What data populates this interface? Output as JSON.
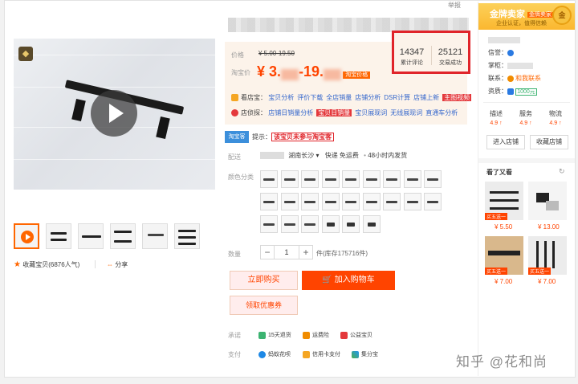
{
  "header": {
    "report_label": "举报"
  },
  "gallery": {
    "collect_label": "收藏宝贝",
    "collect_count": "(6876人气)",
    "share_label": "分享"
  },
  "price": {
    "price_label": "价格",
    "original_price": "¥ 5.00-19.50",
    "tb_price_label": "淘宝价",
    "tb_price_a": "¥ 3.",
    "tb_price_b": "-19.",
    "promo_tag": "淘宝价格"
  },
  "stats": [
    {
      "num": "14347",
      "cap": "累计评论"
    },
    {
      "num": "25121",
      "cap": "交易成功"
    }
  ],
  "tools": {
    "row1_label": "看店宝：",
    "row1_links": [
      "宝贝分析",
      "评价下载",
      "全店销量",
      "店铺分析",
      "DSR计算",
      "店铺上新"
    ],
    "row1_tag": "主图视频",
    "row2_label": "店侦探：",
    "row2_links": [
      "店铺日销量分析"
    ],
    "row2_tag": "宝贝日销量",
    "row2_links_b": [
      "宝贝展现词",
      "无线展现词",
      "直通车分析"
    ]
  },
  "guarantee": {
    "badge": "淘宝客",
    "note_prefix": "提示：",
    "note_red": "该宝贝未参与淘宝客"
  },
  "shipping": {
    "label": "配送",
    "dest": "湖南长沙",
    "fee": "快递 免运费",
    "time": "48小时内发货"
  },
  "sku": {
    "label": "颜色分类"
  },
  "quantity": {
    "label": "数量",
    "minus": "−",
    "value": "1",
    "plus": "+",
    "note": "件(库存175716件)"
  },
  "actions": {
    "buy": "立即购买",
    "cart": "加入购物车",
    "coupon": "领取优惠券"
  },
  "service": {
    "promise_label": "承诺",
    "promise_items": [
      "15天退货",
      "运费险",
      "公益宝贝"
    ],
    "pay_label": "支付",
    "pay_items": [
      "蚂蚁花呗",
      "信用卡支付",
      "集分宝"
    ]
  },
  "shop": {
    "title": "金牌卖家",
    "title_tag": "金牌卖家",
    "subtitle": "企业认证，值得信赖",
    "gold_icon_text": "金",
    "credit_label": "信誉：",
    "seller_label": "掌柜：",
    "contact_label": "联系：",
    "contact_value": "和我联系",
    "qual_label": "资质：",
    "qual_value": "1000元",
    "ratings": [
      {
        "name": "描述",
        "value": "4.9 ↑"
      },
      {
        "name": "服务",
        "value": "4.9 ↑"
      },
      {
        "name": "物流",
        "value": "4.9 ↑"
      }
    ],
    "enter_btn": "进入店铺",
    "fav_btn": "收藏店铺",
    "seen_title": "看了又看",
    "products": [
      {
        "price": "¥ 5.50",
        "tag": "买五送一"
      },
      {
        "price": "¥ 13.00",
        "tag": ""
      },
      {
        "price": "¥ 7.00",
        "tag": "买五送一"
      },
      {
        "price": "¥ 7.00",
        "tag": "买五送一"
      }
    ]
  },
  "watermark": "知乎 @花和尚"
}
